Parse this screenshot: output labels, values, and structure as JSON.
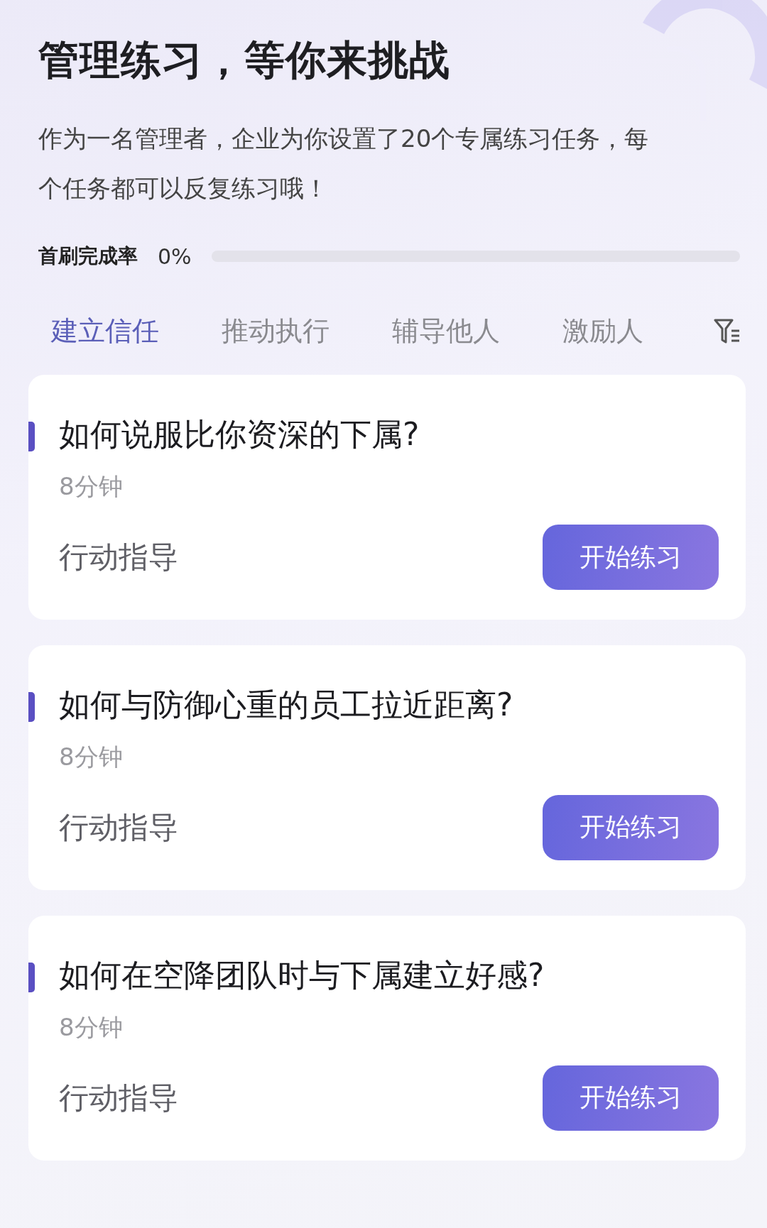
{
  "header": {
    "title": "管理练习，等你来挑战",
    "description": "作为一名管理者，企业为你设置了20个专属练习任务，每个任务都可以反复练习哦！"
  },
  "progress": {
    "label": "首刷完成率",
    "reading": "0%",
    "level": 0
  },
  "tabs": [
    {
      "label": "建立信任",
      "selected": true
    },
    {
      "label": "推动执行",
      "selected": false
    },
    {
      "label": "辅导他人",
      "selected": false
    },
    {
      "label": "激励人",
      "selected": false
    }
  ],
  "tasks": [
    {
      "title": "如何说服比你资深的下属?",
      "duration": "8分钟",
      "tag": "行动指导",
      "button": "开始练习"
    },
    {
      "title": "如何与防御心重的员工拉近距离?",
      "duration": "8分钟",
      "tag": "行动指导",
      "button": "开始练习"
    },
    {
      "title": "如何在空降团队时与下属建立好感?",
      "duration": "8分钟",
      "tag": "行动指导",
      "button": "开始练习"
    }
  ]
}
